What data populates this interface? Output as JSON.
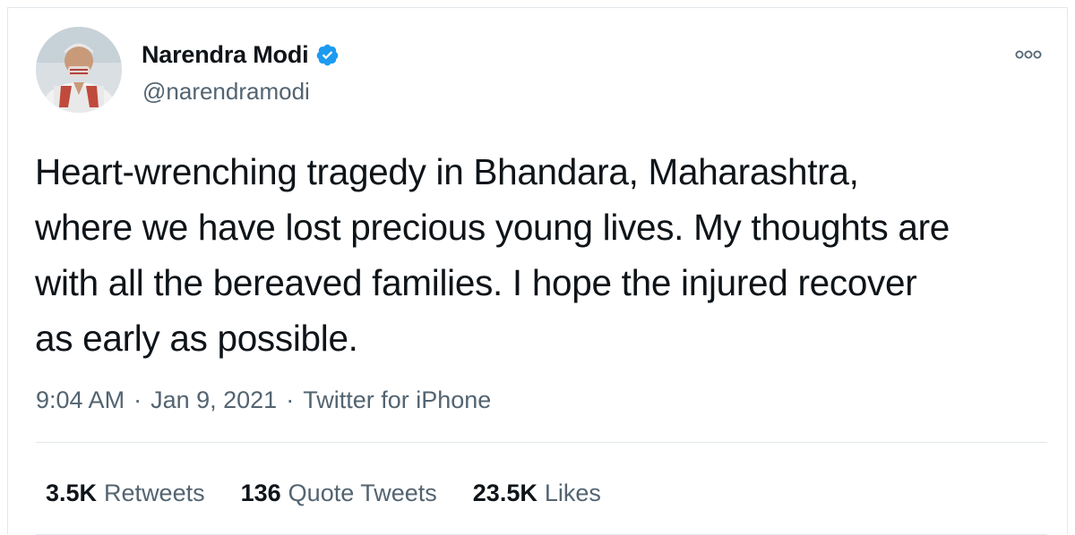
{
  "author": {
    "display_name": "Narendra Modi",
    "handle": "@narendramodi",
    "verified": true,
    "avatar_icon": "profile-photo"
  },
  "tweet": {
    "text": "Heart-wrenching tragedy in Bhandara, Maharashtra,\nwhere we have lost precious young lives. My thoughts are\nwith all the bereaved families. I hope the injured recover\nas early as possible.",
    "time": "9:04 AM",
    "date": "Jan 9, 2021",
    "source": "Twitter for iPhone",
    "separator": "·"
  },
  "stats": [
    {
      "count": "3.5K",
      "label": "Retweets"
    },
    {
      "count": "136",
      "label": "Quote Tweets"
    },
    {
      "count": "23.5K",
      "label": "Likes"
    }
  ],
  "icons": {
    "more": "more-options-icon",
    "verified": "verified-badge-icon"
  },
  "colors": {
    "primary_text": "#0f1419",
    "secondary_text": "#536471",
    "verified_blue": "#1d9bf0",
    "divider": "#e1e8ed"
  }
}
